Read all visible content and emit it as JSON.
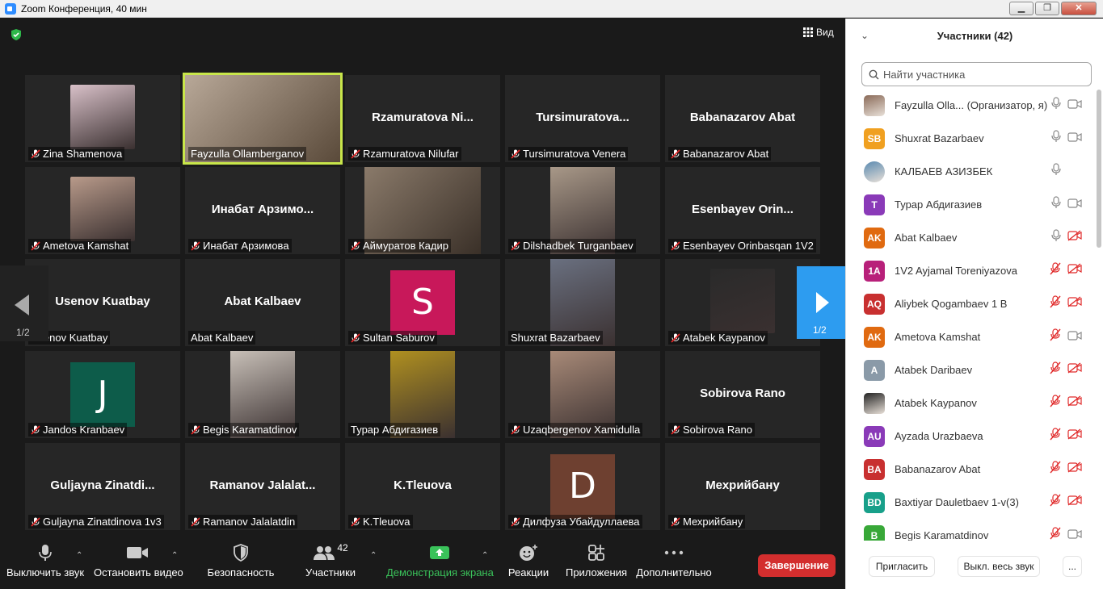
{
  "window": {
    "title": "Zoom Конференция, 40 мин"
  },
  "view": {
    "label": "Вид"
  },
  "pager": {
    "left": "1/2",
    "right": "1/2"
  },
  "tiles": [
    {
      "name": "Zina Shamenova",
      "center": "",
      "kind": "photo",
      "muted": true,
      "color": "#d8c0c8"
    },
    {
      "name": "Fayzulla Ollamberganov",
      "center": "",
      "kind": "video",
      "muted": false,
      "color": "#8a6a50"
    },
    {
      "name": "Rzamuratova Nilufar",
      "center": "Rzamuratova Ni...",
      "kind": "name",
      "muted": true
    },
    {
      "name": "Tursimuratova Venera",
      "center": "Tursimuratova...",
      "kind": "name",
      "muted": true
    },
    {
      "name": "Babanazarov Abat",
      "center": "Babanazarov Abat",
      "kind": "name",
      "muted": true
    },
    {
      "name": "Ametova Kamshat",
      "center": "",
      "kind": "photo",
      "muted": true,
      "color": "#b89a8a"
    },
    {
      "name": "Инабат Арзимова",
      "center": "Инабат Арзимо...",
      "kind": "name",
      "muted": true
    },
    {
      "name": "Аймуратов Кадир",
      "center": "",
      "kind": "video",
      "muted": true,
      "color": "#6a5a4a"
    },
    {
      "name": "Dilshadbek Turganbaev",
      "center": "",
      "kind": "photo",
      "muted": true,
      "color": "#a89888"
    },
    {
      "name": "Esenbayev Orinbasqan 1V2",
      "center": "Esenbayev Orin...",
      "kind": "name",
      "muted": true
    },
    {
      "name": "Usenov Kuatbay",
      "center": "Usenov Kuatbay",
      "kind": "name",
      "muted": false
    },
    {
      "name": "Abat Kalbaev",
      "center": "Abat Kalbaev",
      "kind": "name",
      "muted": false
    },
    {
      "name": "Sultan Saburov",
      "center": "",
      "kind": "avatar",
      "letter": "S",
      "muted": true,
      "color": "#c8185a"
    },
    {
      "name": "Shuxrat Bazarbaev",
      "center": "",
      "kind": "photo",
      "muted": false,
      "color": "#6a7080"
    },
    {
      "name": "Atabek Kaypanov",
      "center": "",
      "kind": "photo",
      "muted": true,
      "color": "#2a2a2a"
    },
    {
      "name": "Jandos Kranbaev",
      "center": "",
      "kind": "avatar",
      "letter": "J",
      "muted": true,
      "color": "#0d5c4a"
    },
    {
      "name": "Begis Karamatdinov",
      "center": "",
      "kind": "photo",
      "muted": true,
      "color": "#c8c0b8"
    },
    {
      "name": "Турар Абдигазиев",
      "center": "",
      "kind": "photo",
      "muted": false,
      "color": "#b09020"
    },
    {
      "name": "Uzaqbergenov Xamidulla",
      "center": "",
      "kind": "photo",
      "muted": true,
      "color": "#a88a78"
    },
    {
      "name": "Sobirova Rano",
      "center": "Sobirova Rano",
      "kind": "name",
      "muted": true
    },
    {
      "name": "Guljayna Zinatdinova 1v3",
      "center": "Guljayna Zinatdi...",
      "kind": "name",
      "muted": true
    },
    {
      "name": "Ramanov Jalalatdin",
      "center": "Ramanov Jalalat...",
      "kind": "name",
      "muted": true
    },
    {
      "name": "K.Tleuova",
      "center": "K.Tleuova",
      "kind": "name",
      "muted": true
    },
    {
      "name": "Дилфуза Убайдуллаева",
      "center": "",
      "kind": "avatar",
      "letter": "D",
      "muted": true,
      "color": "#6e4030"
    },
    {
      "name": "Мехрийбану",
      "center": "Мехрийбану",
      "kind": "name",
      "muted": true
    }
  ],
  "toolbar": {
    "mute": "Выключить звук",
    "video": "Остановить видео",
    "security": "Безопасность",
    "participants": "Участники",
    "participants_count": "42",
    "share": "Демонстрация экрана",
    "reactions": "Реакции",
    "apps": "Приложения",
    "more": "Дополнительно",
    "end": "Завершение"
  },
  "panel": {
    "title": "Участники (42)",
    "search_placeholder": "Найти участника",
    "invite": "Пригласить",
    "mute_all": "Выкл. весь звук",
    "more": "...",
    "participants": [
      {
        "initials": "",
        "name": "Fayzulla Olla...   (Организатор, я)",
        "color": "#8a6a58",
        "photo": true,
        "mic": "on",
        "cam": "on"
      },
      {
        "initials": "SB",
        "name": "Shuxrat Bazarbaev",
        "color": "#f0a020",
        "mic": "on",
        "cam": "on"
      },
      {
        "initials": "",
        "name": "КАЛБАЕВ АЗИЗБЕК",
        "color": "#5a8ab0",
        "photo": true,
        "mic": "on",
        "cam": "none"
      },
      {
        "initials": "T",
        "name": "Турар Абдигазиев",
        "color": "#8a3ab8",
        "mic": "on",
        "cam": "on"
      },
      {
        "initials": "AK",
        "name": "Abat Kalbaev",
        "color": "#e06a10",
        "mic": "on",
        "cam": "off"
      },
      {
        "initials": "1A",
        "name": "1V2 Ayjamal Toreniyazova",
        "color": "#b8207a",
        "mic": "off",
        "cam": "off"
      },
      {
        "initials": "AQ",
        "name": "Aliybek Qogambaev 1 B",
        "color": "#c83030",
        "mic": "off",
        "cam": "off"
      },
      {
        "initials": "AK",
        "name": "Ametova Kamshat",
        "color": "#e06a10",
        "mic": "off",
        "cam": "on"
      },
      {
        "initials": "A",
        "name": "Atabek Daribaev",
        "color": "#8a9aa8",
        "mic": "off",
        "cam": "off"
      },
      {
        "initials": "",
        "name": "Atabek Kaypanov",
        "color": "#222222",
        "photo": true,
        "mic": "off",
        "cam": "off"
      },
      {
        "initials": "AU",
        "name": "Ayzada Urazbaeva",
        "color": "#8a3ab8",
        "mic": "off",
        "cam": "off"
      },
      {
        "initials": "BA",
        "name": "Babanazarov Abat",
        "color": "#c83030",
        "mic": "off",
        "cam": "off"
      },
      {
        "initials": "BD",
        "name": "Baxtiyar Dauletbaev 1-v(3)",
        "color": "#18a08a",
        "mic": "off",
        "cam": "off"
      },
      {
        "initials": "B",
        "name": "Begis Karamatdinov",
        "color": "#38a838",
        "mic": "off",
        "cam": "on"
      }
    ]
  }
}
